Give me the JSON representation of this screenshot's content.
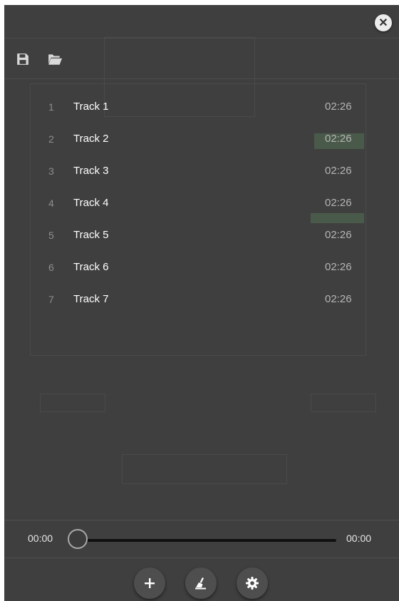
{
  "tracks": [
    {
      "number": "1",
      "title": "Track 1",
      "duration": "02:26"
    },
    {
      "number": "2",
      "title": "Track 2",
      "duration": "02:26"
    },
    {
      "number": "3",
      "title": "Track 3",
      "duration": "02:26"
    },
    {
      "number": "4",
      "title": "Track 4",
      "duration": "02:26"
    },
    {
      "number": "5",
      "title": "Track 5",
      "duration": "02:26"
    },
    {
      "number": "6",
      "title": "Track 6",
      "duration": "02:26"
    },
    {
      "number": "7",
      "title": "Track 7",
      "duration": "02:26"
    }
  ],
  "player": {
    "current_time": "00:00",
    "total_time": "00:00",
    "progress": 0
  },
  "icons": {
    "close": "close-icon",
    "save": "save-icon",
    "open": "folder-open-icon",
    "add": "plus-icon",
    "clear": "broom-icon",
    "settings": "gear-icon"
  },
  "colors": {
    "panel_background": "#3f3f3f",
    "track_title": "#ffffff",
    "track_number": "#8e8e8e",
    "duration": "#b4b4b4"
  }
}
